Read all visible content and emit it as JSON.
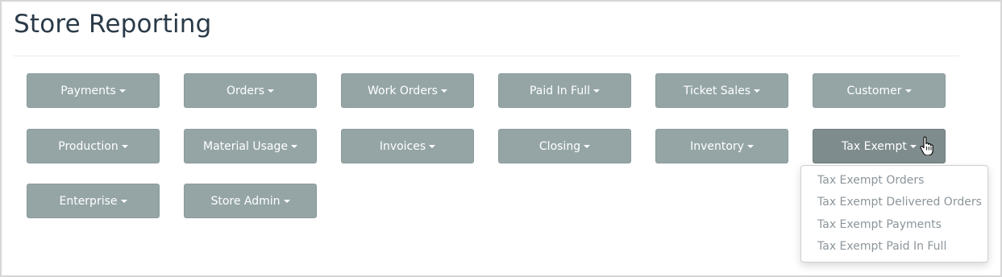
{
  "page": {
    "title": "Store Reporting"
  },
  "buttons": [
    {
      "label": "Payments"
    },
    {
      "label": "Orders"
    },
    {
      "label": "Work Orders"
    },
    {
      "label": "Paid In Full"
    },
    {
      "label": "Ticket Sales"
    },
    {
      "label": "Customer"
    },
    {
      "label": "Production"
    },
    {
      "label": "Material Usage"
    },
    {
      "label": "Invoices"
    },
    {
      "label": "Closing"
    },
    {
      "label": "Inventory"
    },
    {
      "label": "Tax Exempt"
    },
    {
      "label": "Enterprise"
    },
    {
      "label": "Store Admin"
    }
  ],
  "dropdown": {
    "items": [
      {
        "label": "Tax Exempt Orders"
      },
      {
        "label": "Tax Exempt Delivered Orders"
      },
      {
        "label": "Tax Exempt Payments"
      },
      {
        "label": "Tax Exempt Paid In Full"
      }
    ]
  },
  "colors": {
    "button_bg": "#95a5a6",
    "button_active_bg": "#7f8c8d",
    "button_text": "#ffffff",
    "title_text": "#2a3a48",
    "dropdown_text": "#8c959a"
  },
  "icons": {
    "caret": "caret-down-icon",
    "cursor": "hand-pointer-icon"
  }
}
